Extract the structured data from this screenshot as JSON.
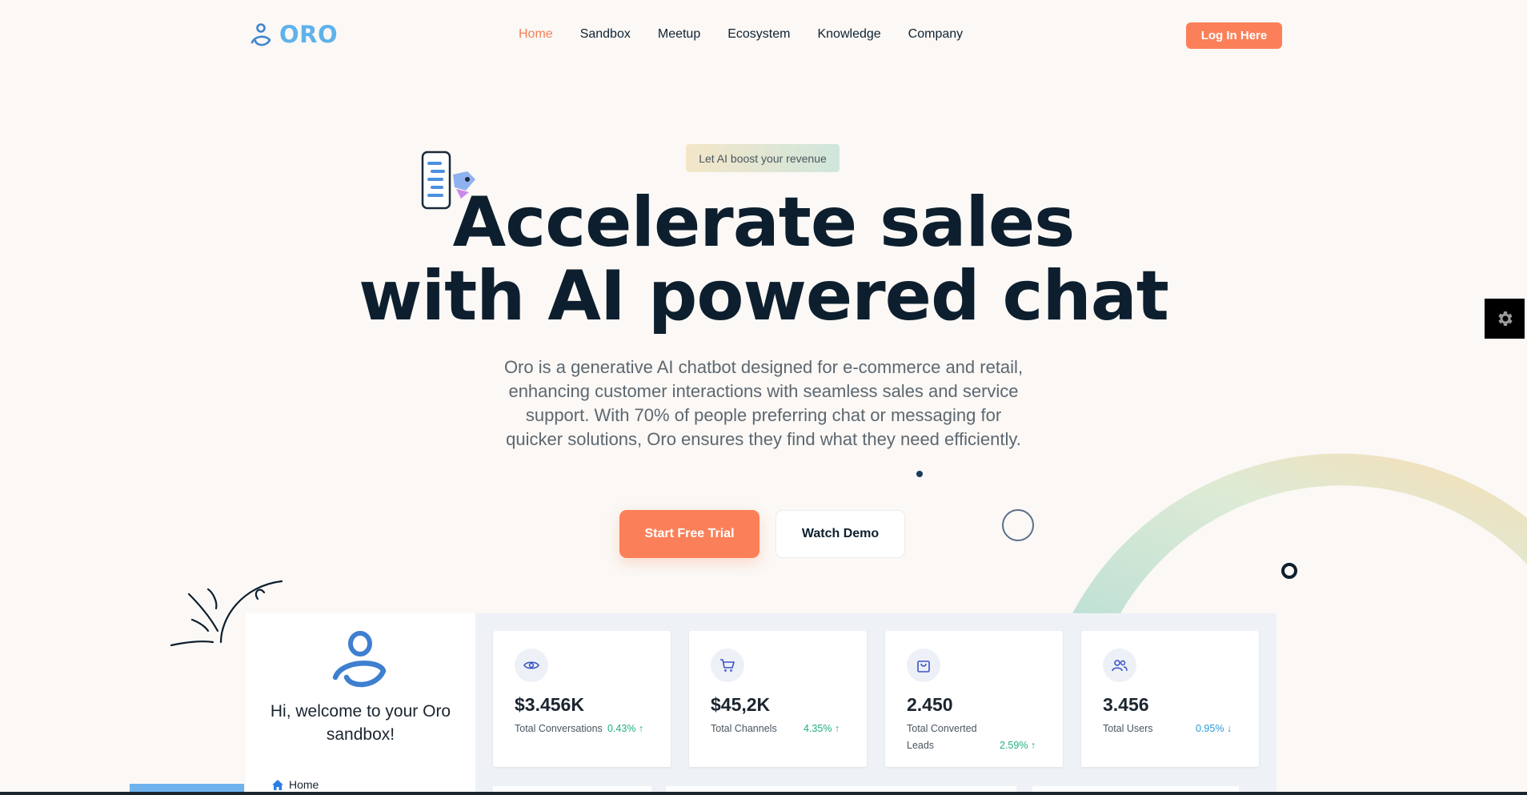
{
  "brand": {
    "name": "ORO"
  },
  "nav": {
    "items": [
      {
        "label": "Home",
        "active": true
      },
      {
        "label": "Sandbox",
        "active": false
      },
      {
        "label": "Meetup",
        "active": false
      },
      {
        "label": "Ecosystem",
        "active": false
      },
      {
        "label": "Knowledge",
        "active": false
      },
      {
        "label": "Company",
        "active": false
      }
    ],
    "login_label": "Log In Here"
  },
  "hero": {
    "badge": "Let AI boost your revenue",
    "title_line1": "Accelerate sales",
    "title_line2": "with AI powered chat",
    "description": "Oro is a generative AI chatbot designed for e-commerce and retail, enhancing customer interactions with seamless sales and service support. With 70% of people preferring chat or messaging for quicker solutions, Oro ensures they find what they need efficiently.",
    "primary_cta": "Start Free Trial",
    "secondary_cta": "Watch Demo"
  },
  "dashboard": {
    "welcome": "Hi, welcome to your Oro sandbox!",
    "side_nav": {
      "home": "Home"
    },
    "stats": [
      {
        "icon": "eye-icon",
        "value": "$3.456K",
        "label": "Total Conversations",
        "delta": "0.43% ↑",
        "trend": "up"
      },
      {
        "icon": "cart-icon",
        "value": "$45,2K",
        "label": "Total Channels",
        "delta": "4.35% ↑",
        "trend": "up"
      },
      {
        "icon": "bag-icon",
        "value": "2.450",
        "label": "Total Converted Leads",
        "delta": "2.59% ↑",
        "trend": "up"
      },
      {
        "icon": "users-icon",
        "value": "3.456",
        "label": "Total Users",
        "delta": "0.95% ↓",
        "trend": "down"
      }
    ]
  },
  "colors": {
    "accent": "#fb8059",
    "brand_blue": "#5eb2ea",
    "heading": "#0d1f2e",
    "background": "#fbf8f5"
  }
}
